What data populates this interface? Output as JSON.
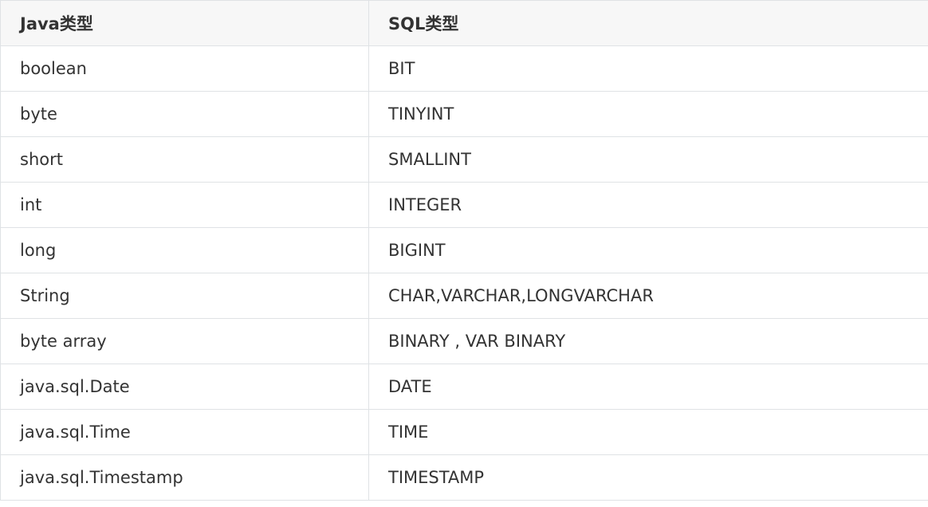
{
  "table": {
    "headers": [
      "Java类型",
      "SQL类型"
    ],
    "rows": [
      [
        "boolean",
        "BIT"
      ],
      [
        "byte",
        "TINYINT"
      ],
      [
        "short",
        "SMALLINT"
      ],
      [
        "int",
        "INTEGER"
      ],
      [
        "long",
        "BIGINT"
      ],
      [
        "String",
        "CHAR,VARCHAR,LONGVARCHAR"
      ],
      [
        "byte array",
        "BINARY , VAR BINARY"
      ],
      [
        "java.sql.Date",
        "DATE"
      ],
      [
        "java.sql.Time",
        "TIME"
      ],
      [
        "java.sql.Timestamp",
        "TIMESTAMP"
      ]
    ]
  }
}
